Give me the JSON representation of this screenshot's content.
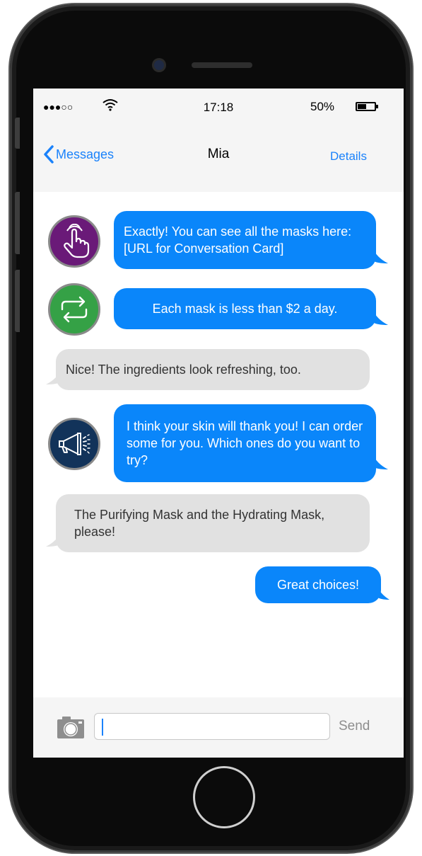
{
  "status_bar": {
    "signal": "●●●○○",
    "time": "17:18",
    "battery": "50%"
  },
  "nav": {
    "back_label": "Messages",
    "title": "Mia",
    "details_label": "Details"
  },
  "messages": [
    {
      "direction": "outgoing",
      "avatar_icon": "touch-hand-icon",
      "text": "Exactly! You can see all the masks here: [URL for Conversation Card]"
    },
    {
      "direction": "outgoing",
      "avatar_icon": "repeat-arrows-icon",
      "text": "Each mask is less than $2 a day."
    },
    {
      "direction": "incoming",
      "text": "Nice! The ingredients look refreshing, too."
    },
    {
      "direction": "outgoing",
      "avatar_icon": "megaphone-icon",
      "text": "I think your skin will thank you! I can order some for you. Which ones do you want to try?"
    },
    {
      "direction": "incoming",
      "text": "The Purifying Mask and the Hydrating Mask, please!"
    },
    {
      "direction": "outgoing",
      "text": "Great choices!"
    }
  ],
  "input": {
    "value": "",
    "send_label": "Send"
  },
  "colors": {
    "outgoing_bubble": "#0a86fa",
    "incoming_bubble": "#e1e1e1",
    "accent": "#1a82fb",
    "avatar_purple": "#6a1a78",
    "avatar_green": "#35a146",
    "avatar_navy": "#12335a"
  }
}
